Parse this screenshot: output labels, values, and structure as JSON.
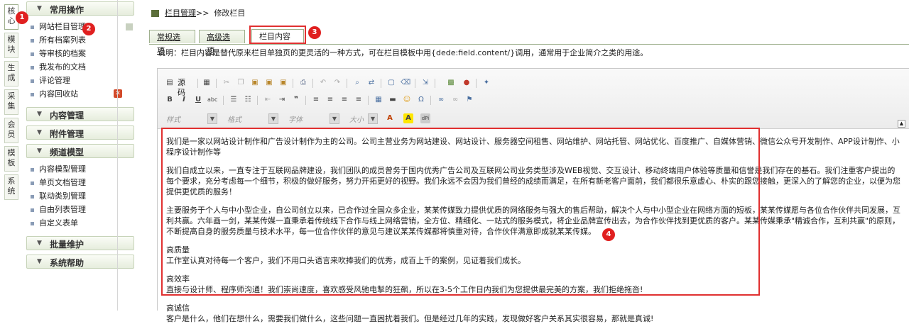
{
  "module_tabs": [
    "核心",
    "模块",
    "生成",
    "采集",
    "会员",
    "模板",
    "系统"
  ],
  "menu": {
    "group_common": "常用操作",
    "items_common": [
      "网站栏目管理",
      "所有档案列表",
      "等审核的档案",
      "我发布的文档",
      "评论管理",
      "内容回收站"
    ],
    "group_content": "内容管理",
    "group_attachment": "附件管理",
    "group_channel": "频道模型",
    "items_channel": [
      "内容模型管理",
      "单页文档管理",
      "联动类别管理",
      "自由列表管理",
      "自定义表单"
    ],
    "group_batch": "批量维护",
    "group_help": "系统帮助"
  },
  "markers": [
    "1",
    "2",
    "3",
    "4"
  ],
  "breadcrumb": {
    "link": "栏目管理",
    "sep": ">>",
    "current": "修改栏目"
  },
  "tabs": [
    "常规选项",
    "高级选项",
    "栏目内容"
  ],
  "description": "说明：栏目内容是替代原来栏目单独页的更灵活的一种方式，可在栏目模板中用{dede:field.content/}调用，通常用于企业简介之类的用途。",
  "toolbar": {
    "source_label": "源码",
    "combo_style": "样式",
    "combo_format": "格式",
    "combo_font": "字体",
    "combo_size": "大小"
  },
  "content": {
    "paragraphs": [
      "我们是一家以网站设计制作和广告设计制作为主的公司。公司主营业务为网站建设、网站设计、服务器空间租售、网站维护、网站托管、网站优化、百度推广、自媒体营销、微信公众号开发制作、APP设计制作、小程序设计制作等",
      "我们自成立以来，一直专注于互联网品牌建设，我们团队的成员曾务于国内优秀广告公司及互联网公司业务类型涉及WEB视觉、交互设计、移动终端用户体验等质量和信誉是我们存在的基石。我们注重客户提出的每个要求，充分考虑每一个细节，积极的做好服务，努力开拓更好的视野。我们永远不会因为我们曾经的成绩而满足，在所有新老客户面前，我们都很乐意虚心、朴实的跟您接触，更深入的了解您的企业，以便为您提供更优质的服务！",
      "主要服务于个人与中小型企业，自公司创立以来，已合作过全国众多企业，某某传媒致力提供优质的网络服务与强大的售后帮助，解决个人与中小型企业在网络方面的短板，某某传媒愿与各位合作伙伴共同发展，互利共赢。六年画一剑，某某传媒一直秉承着传统线下合作与线上网络营销，全方位、精细化、一站式的服务模式，将企业品牌宣传出去，为合作伙伴找到更优质的客户。某某传媒秉承\"精诚合作，互利共赢\"的原则，不断提高自身的服务质量与技术水平，每一位合作伙伴的意见与建议某某传媒都将慎重对待，合作伙伴满意即成就某某传媒。"
    ],
    "quality_title": "高质量",
    "quality_text": "工作室认真对待每一个客户，我们不用口头语言来吹捧我们的优秀，成百上千的案例，见证着我们成长。",
    "efficiency_title": "高效率",
    "efficiency_text": "直接与设计师、程序师沟通！我们崇尚速度，喜欢感受风驰电掣的狂飙，所以在3-5个工作日内我们为您提供最完美的方案，我们拒绝拖沓!",
    "integrity_title": "高诚信",
    "integrity_text": "客户是什么，他们在想什么，需要我们做什么，这些问题一直困扰着我们。但是经过几年的实践，发现做好客户关系其实很容易，那就是真诚!"
  },
  "colors": {
    "marker": "#e02020",
    "highlight": "#e03030",
    "menu_border": "#c6d3b8"
  }
}
